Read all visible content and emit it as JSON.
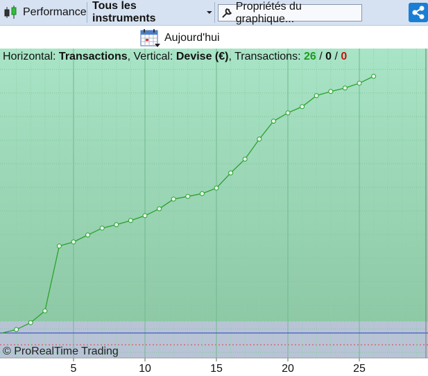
{
  "toolbar": {
    "performance_label": "Performance",
    "instruments_label": "Tous les instruments",
    "properties_label": "Propriétés du graphique..."
  },
  "today_label": "Aujourd'hui",
  "header": {
    "horizontal_label": "Horizontal: ",
    "horizontal_value": "Transactions",
    "vertical_label": ", Vertical: ",
    "vertical_value": "Devise (€)",
    "transactions_label": ", Transactions: ",
    "count_green": "26",
    "sep1": " / ",
    "count_black": "0",
    "sep2": " / ",
    "count_red": "0"
  },
  "copyright": "© ProRealTime Trading",
  "colors": {
    "positive_area_top": "#a8e4c6",
    "positive_area_bottom": "#8ec9a6",
    "negative_area": "#b8c4d6",
    "line": "#2aa12a",
    "grid": "#7fc49a",
    "zero_line": "#2540c0"
  },
  "chart_data": {
    "type": "line",
    "xlabel": "Transactions",
    "ylabel": "Devise (€)",
    "x_ticks": [
      "5",
      "10",
      "15",
      "20",
      "25"
    ],
    "xlim": [
      0,
      29.5
    ],
    "grid": true,
    "series": [
      {
        "x": [
          0,
          1,
          2,
          3,
          4,
          5,
          6,
          7,
          8,
          9,
          10,
          11,
          12,
          13,
          14,
          15,
          16,
          17,
          18,
          19,
          20,
          21,
          22,
          23,
          24,
          25,
          26
        ],
        "values": [
          0,
          5,
          15,
          32,
          126,
          132,
          142,
          152,
          157,
          163,
          170,
          180,
          194,
          198,
          202,
          210,
          232,
          252,
          281,
          307,
          319,
          328,
          344,
          350,
          355,
          362,
          372
        ]
      }
    ]
  }
}
